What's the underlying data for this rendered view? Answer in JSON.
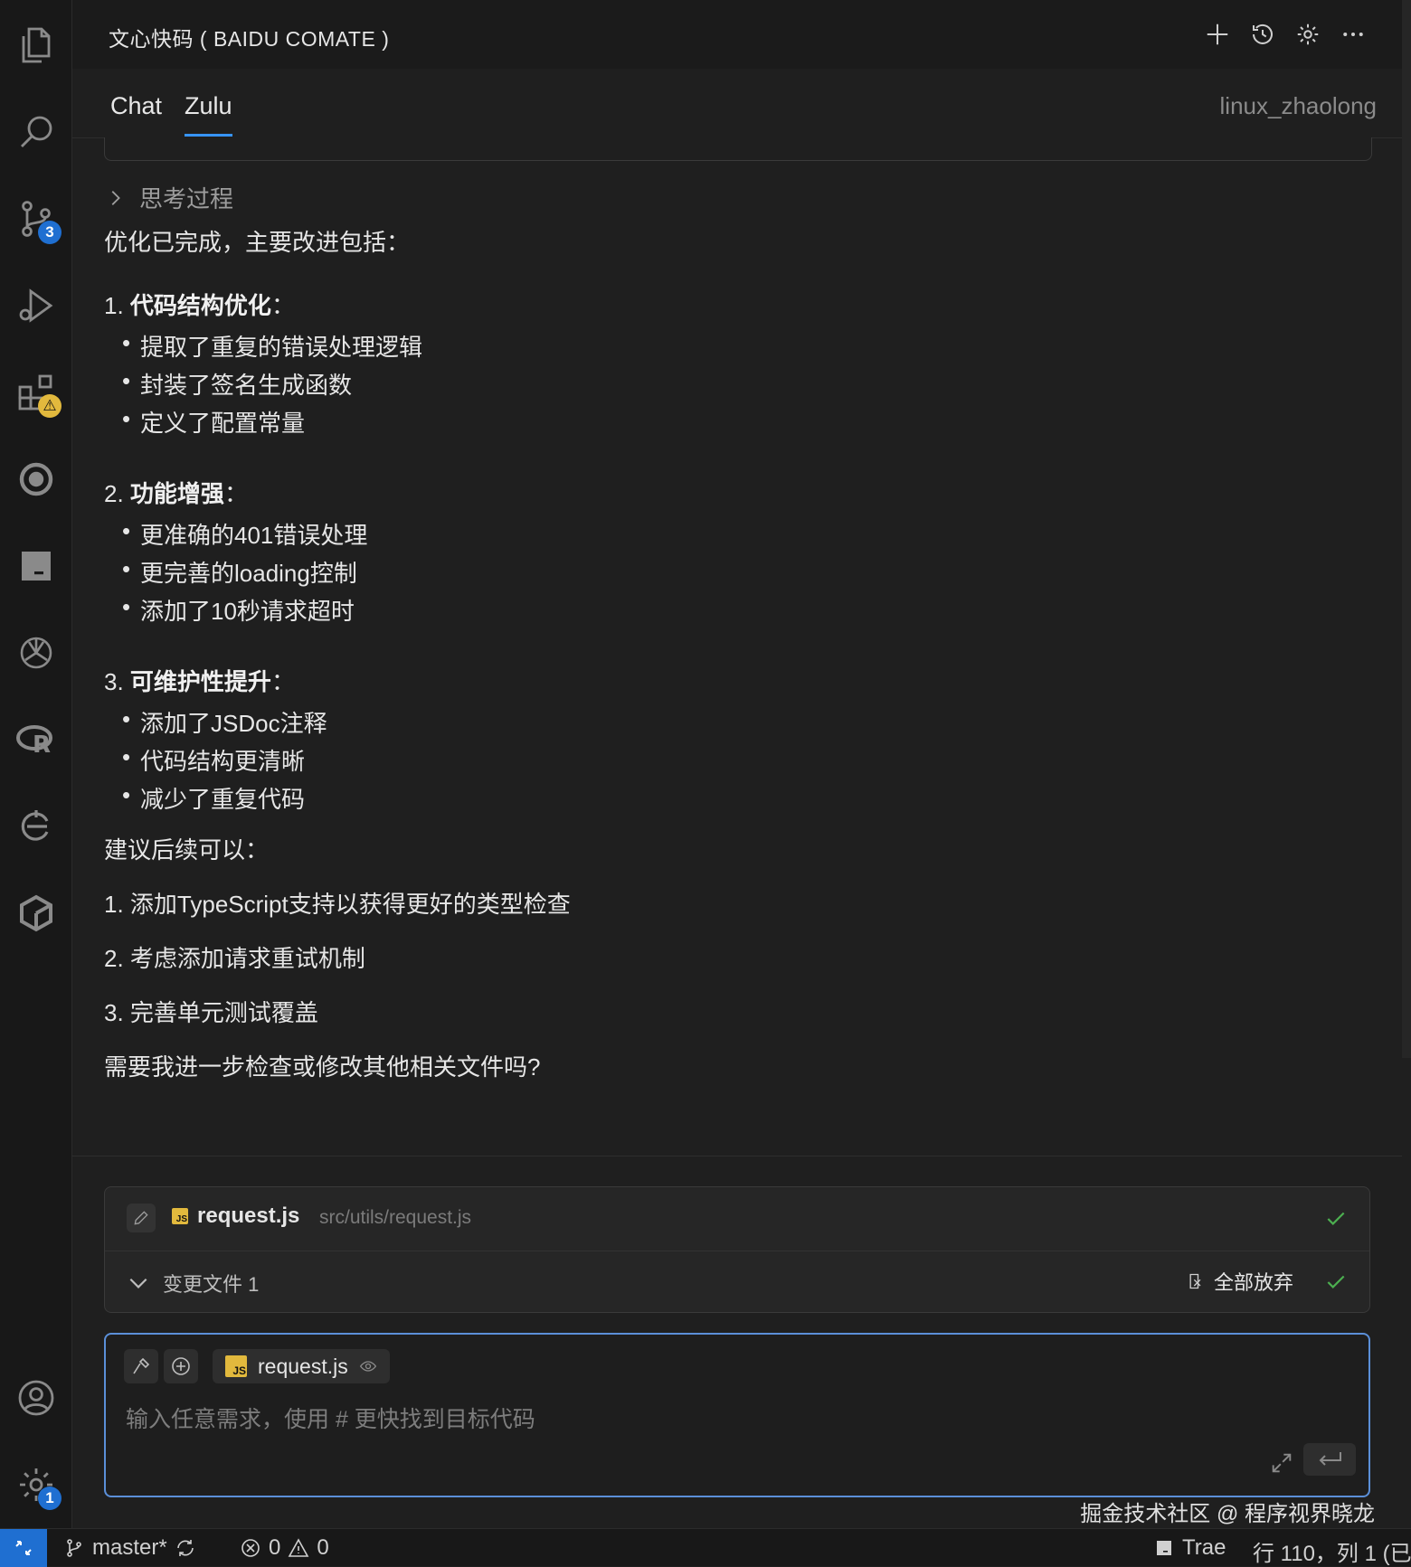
{
  "panel": {
    "title": "文心快码 ( BAIDU COMATE )",
    "tabs": [
      "Chat",
      "Zulu"
    ],
    "active_tab": "Zulu",
    "user": "linux_zhaolong"
  },
  "activity_bar": {
    "icons": [
      "explorer-icon",
      "search-icon",
      "source-control-icon",
      "run-debug-icon",
      "extensions-icon",
      "remote-icon",
      "terminal-icon",
      "openai-icon",
      "r-icon",
      "comate-icon",
      "cube-icon",
      "account-icon",
      "settings-icon"
    ],
    "badges": {
      "source_control": "3",
      "settings": "1"
    }
  },
  "message": {
    "thinking_label": "思考过程",
    "intro": "优化已完成，主要改进包括：",
    "sections": [
      {
        "num": "1.",
        "title": "代码结构优化",
        "colon": "：",
        "items": [
          "提取了重复的错误处理逻辑",
          "封装了签名生成函数",
          "定义了配置常量"
        ]
      },
      {
        "num": "2.",
        "title": "功能增强",
        "colon": "：",
        "items": [
          "更准确的401错误处理",
          "更完善的loading控制",
          "添加了10秒请求超时"
        ]
      },
      {
        "num": "3.",
        "title": "可维护性提升",
        "colon": "：",
        "items": [
          "添加了JSDoc注释",
          "代码结构更清晰",
          "减少了重复代码"
        ]
      }
    ],
    "suggest_intro": "建议后续可以：",
    "suggestions": [
      "1. 添加TypeScript支持以获得更好的类型检查",
      "2. 考虑添加请求重试机制",
      "3. 完善单元测试覆盖"
    ],
    "closing": "需要我进一步检查或修改其他相关文件吗?"
  },
  "changes": {
    "file_name": "request.js",
    "file_path": "src/utils/request.js",
    "summary": "变更文件 1",
    "discard_all": "全部放弃",
    "js_badge": "JS"
  },
  "input": {
    "chip_file": "request.js",
    "placeholder": "输入任意需求，使用 # 更快找到目标代码"
  },
  "watermark": "掘金技术社区 @ 程序视界晓龙",
  "status_bar": {
    "branch": "master*",
    "errors": "0",
    "warnings": "0",
    "trae": "Trae",
    "position": "行 110，列 1 (已"
  }
}
